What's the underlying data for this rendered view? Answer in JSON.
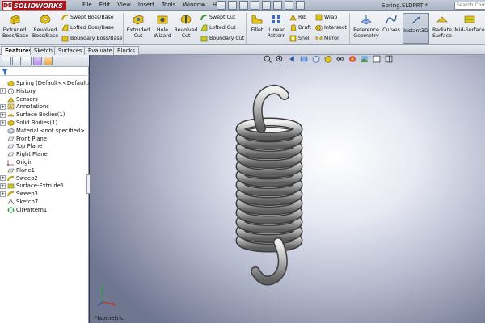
{
  "app": {
    "brand": "SOLIDWORKS",
    "brand_mark": "DS",
    "document_title": "Spring.SLDPRT *",
    "search_placeholder": "Search Com"
  },
  "menu": [
    "File",
    "Edit",
    "View",
    "Insert",
    "Tools",
    "Window",
    "Help"
  ],
  "ribbon": {
    "extruded_boss": "Extruded Boss/Base",
    "revolved_boss": "Revolved Boss/Base",
    "swept_boss": "Swept Boss/Base",
    "lofted_boss": "Lofted Boss/Base",
    "boundary_boss": "Boundary Boss/Base",
    "extruded_cut": "Extruded Cut",
    "hole_wizard": "Hole Wizard",
    "revolved_cut": "Revolved Cut",
    "swept_cut": "Swept Cut",
    "lofted_cut": "Lofted Cut",
    "boundary_cut": "Boundary Cut",
    "fillet": "Fillet",
    "linear_pattern": "Linear Pattern",
    "rib": "Rib",
    "draft": "Draft",
    "shell": "Shell",
    "wrap": "Wrap",
    "intersect": "Intersect",
    "mirror": "Mirror",
    "reference_geometry": "Reference Geometry",
    "curves": "Curves",
    "instant3d": "Instant3D",
    "radiate_surface": "Radiate Surface",
    "mid_surface": "Mid-Surface"
  },
  "tabs": [
    "Features",
    "Sketch",
    "Surfaces",
    "Evaluate",
    "Blocks"
  ],
  "tree": {
    "root": "Spring  (Default<<Default>_Disp",
    "items": [
      {
        "label": "History",
        "icon": "history-icon",
        "expandable": true
      },
      {
        "label": "Sensors",
        "icon": "sensor-icon",
        "expandable": false
      },
      {
        "label": "Annotations",
        "icon": "annotation-icon",
        "expandable": true
      },
      {
        "label": "Surface Bodies(1)",
        "icon": "surface-body-icon",
        "expandable": true
      },
      {
        "label": "Solid Bodies(1)",
        "icon": "solid-body-icon",
        "expandable": true
      },
      {
        "label": "Material <not specified>",
        "icon": "material-icon",
        "expandable": false
      },
      {
        "label": "Front Plane",
        "icon": "plane-icon",
        "expandable": false
      },
      {
        "label": "Top Plane",
        "icon": "plane-icon",
        "expandable": false
      },
      {
        "label": "Right Plane",
        "icon": "plane-icon",
        "expandable": false
      },
      {
        "label": "Origin",
        "icon": "origin-icon",
        "expandable": false
      },
      {
        "label": "Plane1",
        "icon": "plane-icon",
        "expandable": false
      },
      {
        "label": "Sweep2",
        "icon": "sweep-icon",
        "expandable": true
      },
      {
        "label": "Surface-Extrude1",
        "icon": "surface-extrude-icon",
        "expandable": true
      },
      {
        "label": "Sweep3",
        "icon": "sweep-icon",
        "expandable": true
      },
      {
        "label": "Sketch7",
        "icon": "sketch-icon",
        "expandable": false
      },
      {
        "label": "CirPattern1",
        "icon": "circular-pattern-icon",
        "expandable": false
      }
    ]
  },
  "viewport": {
    "view_label": "*Isometric"
  },
  "colors": {
    "brand": "#b3141c",
    "feature_yellow": "#e0b400",
    "background_top": "#ffffff",
    "background_bottom": "#6f7690",
    "spring": "#9b9b9b"
  }
}
